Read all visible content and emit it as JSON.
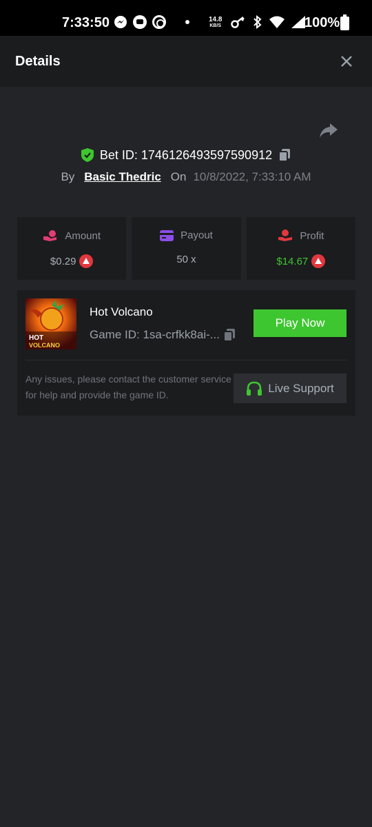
{
  "status_bar": {
    "time": "7:33:50",
    "net_speed": "14.8",
    "net_unit": "KB/S",
    "battery": "100%"
  },
  "header": {
    "title": "Details",
    "close_icon": "close-icon"
  },
  "bet": {
    "bet_id_label": "Bet ID: 1746126493597590912",
    "by_label": "By",
    "user": "Basic Thedric",
    "on_label": "On",
    "date": "10/8/2022, 7:33:10 AM"
  },
  "stats": {
    "amount": {
      "label": "Amount",
      "value": "$0.29",
      "icon": "money-hand-icon",
      "icon_color": "#e23d75"
    },
    "payout": {
      "label": "Payout",
      "value": "50 x",
      "icon": "card-icon",
      "icon_color": "#8d4de8"
    },
    "profit": {
      "label": "Profit",
      "value": "$14.67",
      "icon": "profit-hand-icon",
      "icon_color": "#e0383e"
    }
  },
  "game": {
    "name": "Hot Volcano",
    "game_id": "Game ID: 1sa-crfkk8ai-...",
    "thumb_text_1": "HOT",
    "thumb_text_2": "VOLCANO",
    "play_label": "Play Now",
    "help_text": "Any issues, please contact the customer service for help and provide the game ID.",
    "support_label": "Live Support"
  },
  "colors": {
    "accent_green": "#3ec630",
    "background": "#232427",
    "card": "#1b1c1e",
    "coin_red": "#e0383e"
  }
}
